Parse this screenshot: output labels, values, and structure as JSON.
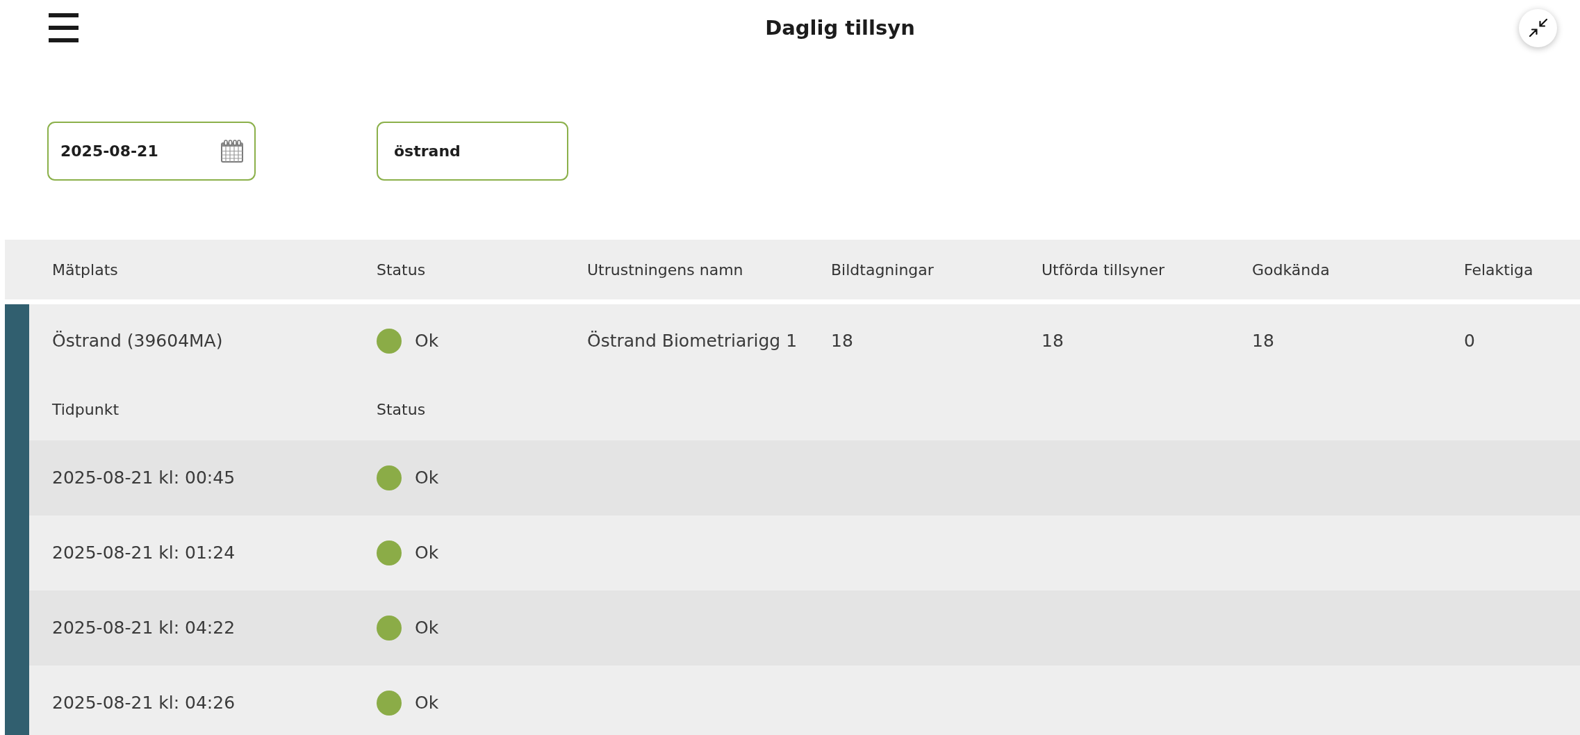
{
  "header": {
    "title": "Daglig tillsyn"
  },
  "filters": {
    "date": {
      "value": "2025-08-21"
    },
    "search": {
      "value": "östrand"
    }
  },
  "table": {
    "columns": [
      "Mätplats",
      "Status",
      "Utrustningens namn",
      "Bildtagningar",
      "Utförda tillsyner",
      "Godkända",
      "Felaktiga"
    ],
    "rows": [
      {
        "expanded": true,
        "location": "Östrand (39604MA)",
        "status": {
          "label": "Ok",
          "color": "#8bac47"
        },
        "equipment": "Östrand Biometriarigg 1",
        "images": "18",
        "inspections": "18",
        "approved": "18",
        "faulty": "0",
        "details": {
          "columns": [
            "Tidpunkt",
            "Status"
          ],
          "rows": [
            {
              "time": "2025-08-21 kl: 00:45",
              "status": {
                "label": "Ok",
                "color": "#8bac47"
              }
            },
            {
              "time": "2025-08-21 kl: 01:24",
              "status": {
                "label": "Ok",
                "color": "#8bac47"
              }
            },
            {
              "time": "2025-08-21 kl: 04:22",
              "status": {
                "label": "Ok",
                "color": "#8bac47"
              }
            },
            {
              "time": "2025-08-21 kl: 04:26",
              "status": {
                "label": "Ok",
                "color": "#8bac47"
              }
            }
          ]
        }
      }
    ]
  }
}
